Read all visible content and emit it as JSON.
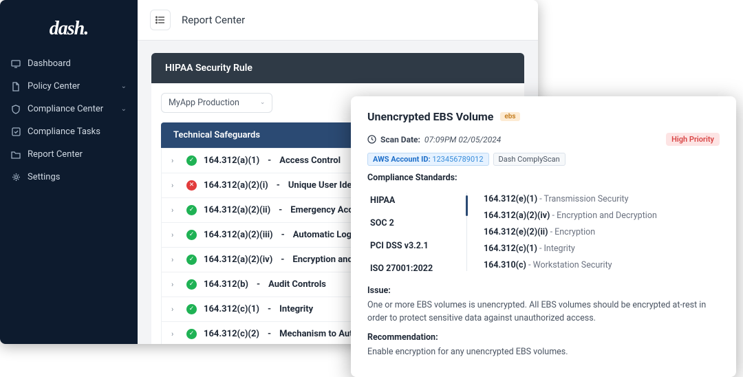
{
  "brand": "dash",
  "sidebar": {
    "items": [
      {
        "label": "Dashboard",
        "icon": "monitor",
        "expandable": false
      },
      {
        "label": "Policy Center",
        "icon": "file",
        "expandable": true
      },
      {
        "label": "Compliance Center",
        "icon": "shield",
        "expandable": true
      },
      {
        "label": "Compliance Tasks",
        "icon": "check-square",
        "expandable": false
      },
      {
        "label": "Report Center",
        "icon": "folder",
        "expandable": false
      },
      {
        "label": "Settings",
        "icon": "gear",
        "expandable": false
      }
    ]
  },
  "topbar": {
    "title": "Report Center"
  },
  "page": {
    "header": "HIPAA Security Rule",
    "scope_selector": "MyApp Production",
    "section": "Technical Safeguards",
    "rows": [
      {
        "status": "ok",
        "code": "164.312(a)(1)",
        "label": "Access Control"
      },
      {
        "status": "bad",
        "code": "164.312(a)(2)(i)",
        "label": "Unique User Identification"
      },
      {
        "status": "ok",
        "code": "164.312(a)(2)(ii)",
        "label": "Emergency Access Procedure"
      },
      {
        "status": "ok",
        "code": "164.312(a)(2)(iii)",
        "label": "Automatic Logoff"
      },
      {
        "status": "ok",
        "code": "164.312(a)(2)(iv)",
        "label": "Encryption and Decryption"
      },
      {
        "status": "ok",
        "code": "164.312(b)",
        "label": "Audit Controls"
      },
      {
        "status": "ok",
        "code": "164.312(c)(1)",
        "label": "Integrity"
      },
      {
        "status": "ok",
        "code": "164.312(c)(2)",
        "label": "Mechanism to Authenticate Electronic PHI"
      }
    ]
  },
  "detail": {
    "title": "Unencrypted EBS Volume",
    "resource_tag": "ebs",
    "scan_label": "Scan Date:",
    "scan_value": "07:09PM 02/05/2024",
    "account_label": "AWS Account ID:",
    "account_value": "123456789012",
    "scanner": "Dash ComplyScan",
    "priority": "High Priority",
    "standards_label": "Compliance Standards:",
    "standard_tabs": [
      "HIPAA",
      "SOC 2",
      "PCI DSS v3.2.1",
      "ISO 27001:2022"
    ],
    "findings": [
      {
        "code": "164.312(e)(1)",
        "desc": "Transmission Security"
      },
      {
        "code": "164.312(a)(2)(iv)",
        "desc": "Encryption and Decryption"
      },
      {
        "code": "164.312(e)(2)(ii)",
        "desc": "Encryption"
      },
      {
        "code": "164.312(c)(1)",
        "desc": "Integrity"
      },
      {
        "code": "164.310(c)",
        "desc": "Workstation Security"
      }
    ],
    "issue_label": "Issue:",
    "issue_text": "One or more EBS volumes is unencrypted. All EBS volumes should be encrypted at-rest in order to protect sensitive data against unauthorized access.",
    "rec_label": "Recommendation:",
    "rec_text": "Enable encryption for any unencrypted EBS volumes."
  }
}
